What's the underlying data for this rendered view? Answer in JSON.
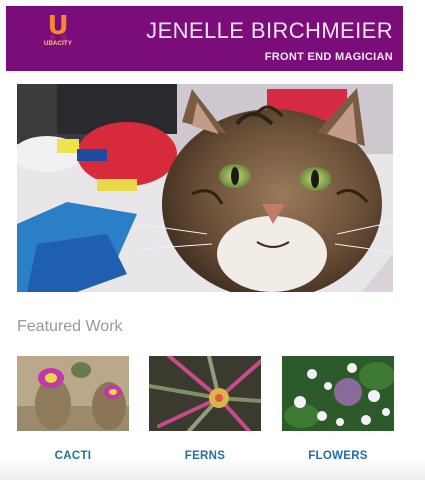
{
  "header": {
    "logo_mark": "U",
    "logo_text": "UDACITY",
    "name": "JENELLE BIRCHMEIER",
    "tagline": "FRONT END MAGICIAN"
  },
  "hero": {
    "subject": "tabby cat portrait"
  },
  "featured": {
    "title": "Featured Work",
    "items": [
      {
        "label": "CACTI"
      },
      {
        "label": "FERNS"
      },
      {
        "label": "FLOWERS"
      }
    ]
  },
  "colors": {
    "header_bg": "#7b0d7b",
    "logo_orange": "#f08a2c",
    "link_blue": "#1f6fa8",
    "muted_heading": "#9a9a9a"
  }
}
